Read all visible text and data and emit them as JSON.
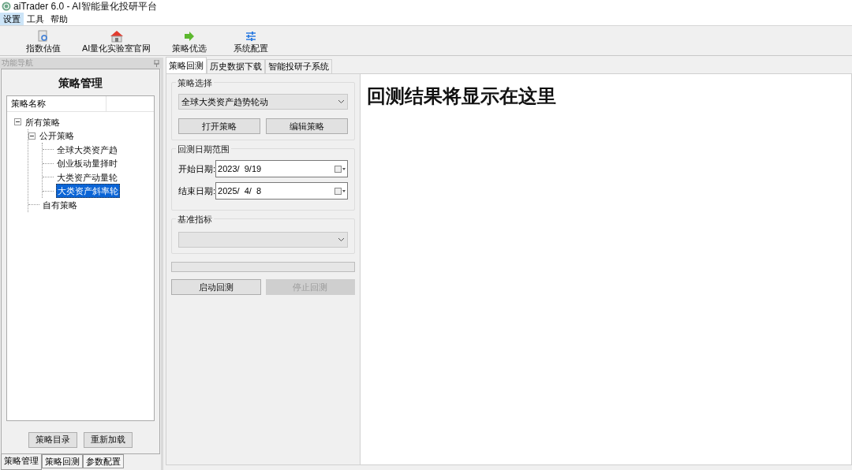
{
  "window": {
    "title": "aiTrader 6.0 - AI智能量化投研平台"
  },
  "menu": [
    {
      "label": "设置",
      "selected": true
    },
    {
      "label": "工具",
      "selected": false
    },
    {
      "label": "帮助",
      "selected": false
    }
  ],
  "toolbar": [
    {
      "label": "指数估值",
      "kind": "magnifier"
    },
    {
      "label": "AI量化实验室官网",
      "kind": "house"
    },
    {
      "label": "策略优选",
      "kind": "arrow"
    },
    {
      "label": "系统配置",
      "kind": "sliders"
    }
  ],
  "nav_panel": {
    "title": "功能导航",
    "heading": "策略管理",
    "column_header": "策略名称",
    "tree": [
      {
        "label": "所有策略",
        "expanded": true,
        "selected": false,
        "children": [
          {
            "label": "公开策略",
            "expanded": true,
            "selected": false,
            "children": [
              {
                "label": "全球大类资产趋",
                "selected": false
              },
              {
                "label": "创业板动量择时",
                "selected": false
              },
              {
                "label": "大类资产动量轮",
                "selected": false
              },
              {
                "label": "大类资产斜率轮",
                "selected": true
              }
            ]
          },
          {
            "label": "自有策略",
            "selected": false
          }
        ]
      }
    ],
    "buttons": [
      "策略目录",
      "重新加载"
    ],
    "tabs": [
      {
        "label": "策略管理",
        "selected": true
      },
      {
        "label": "策略回测",
        "selected": false
      },
      {
        "label": "参数配置",
        "selected": false
      }
    ]
  },
  "tabs": [
    {
      "label": "策略回测",
      "selected": true
    },
    {
      "label": "历史数据下载",
      "selected": false
    },
    {
      "label": "智能投研子系统",
      "selected": false
    }
  ],
  "strategy_group": {
    "title": "策略选择",
    "dropdown": "全球大类资产趋势轮动",
    "buttons": [
      "打开策略",
      "编辑策略"
    ]
  },
  "date_group": {
    "title": "回测日期范围",
    "fields": [
      {
        "label": "开始日期:",
        "value": "2023/  9/19"
      },
      {
        "label": "结束日期:",
        "value": "2025/  4/  8"
      }
    ]
  },
  "benchmark_group": {
    "title": "基准指标"
  },
  "progress": {
    "level": 0
  },
  "actions": [
    {
      "label": "启动回测",
      "disabled": false
    },
    {
      "label": "停止回测",
      "disabled": true
    }
  ],
  "result": {
    "message": "回测结果将显示在这里"
  }
}
